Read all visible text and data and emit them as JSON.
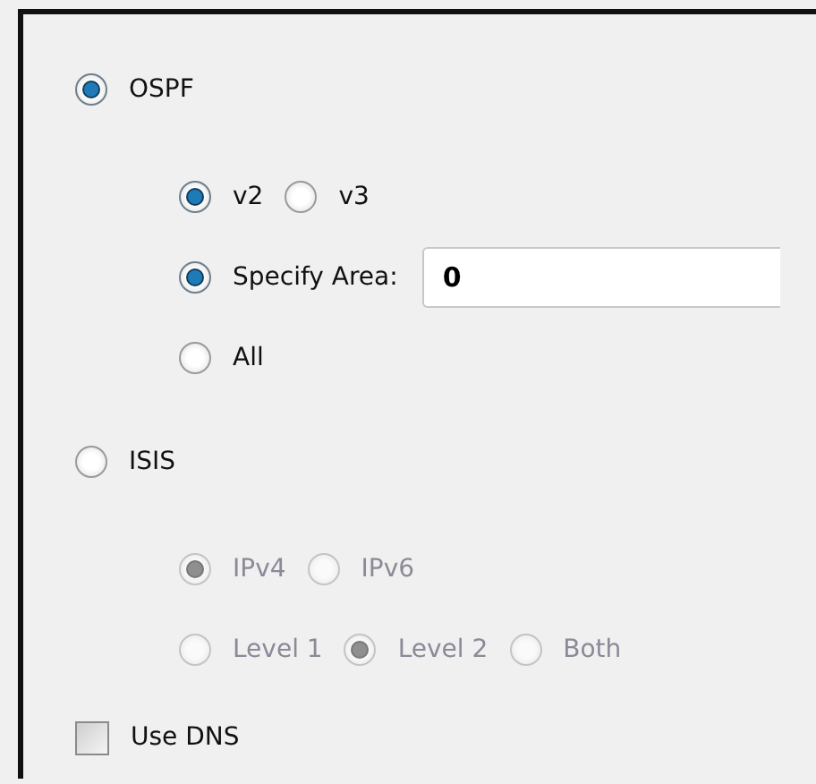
{
  "ospf": {
    "label": "OSPF",
    "selected": true,
    "rows": [
      [
        {
          "label": "v2",
          "selected": true,
          "disabled": false
        },
        {
          "label": "v3",
          "selected": false,
          "disabled": false
        }
      ],
      [
        {
          "label": "Specify Area:",
          "selected": true,
          "disabled": false,
          "value": "0"
        }
      ],
      [
        {
          "label": "All",
          "selected": false,
          "disabled": false
        }
      ]
    ]
  },
  "isis": {
    "label": "ISIS",
    "selected": false,
    "rows": [
      [
        {
          "label": "IPv4",
          "selected": true,
          "disabled": true
        },
        {
          "label": "IPv6",
          "selected": false,
          "disabled": true
        }
      ],
      [
        {
          "label": "Level 1",
          "selected": false,
          "disabled": true
        },
        {
          "label": "Level 2",
          "selected": true,
          "disabled": true
        },
        {
          "label": "Both",
          "selected": false,
          "disabled": true
        }
      ]
    ]
  },
  "use_dns": {
    "label": "Use DNS",
    "checked": false
  }
}
